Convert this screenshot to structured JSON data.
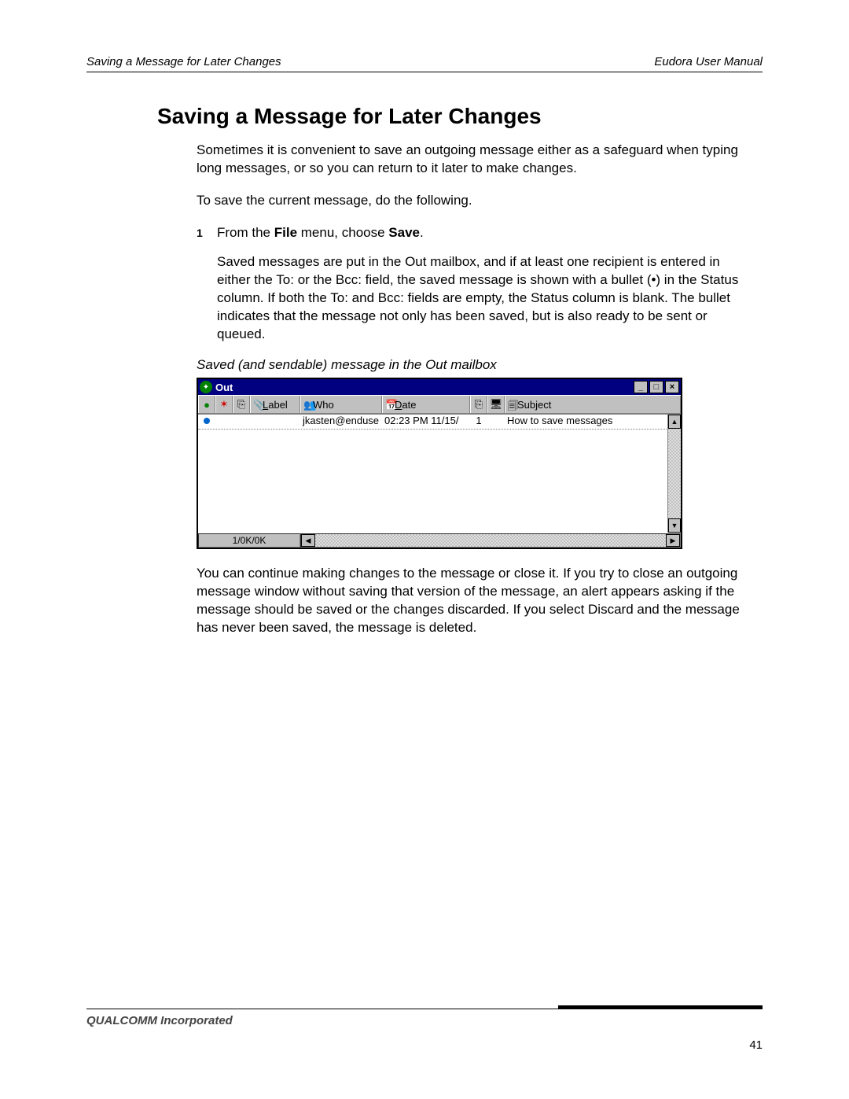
{
  "header": {
    "left": "Saving a Message for Later Changes",
    "right": "Eudora User Manual"
  },
  "title": "Saving a Message for Later Changes",
  "para1": "Sometimes it is convenient to save an outgoing message either as a safeguard when typing long messages, or so you can return to it later to make changes.",
  "para2": "To save the current message, do the following.",
  "step": {
    "num": "1",
    "text_prefix": "From the ",
    "menu": "File",
    "text_mid": " menu, choose ",
    "action": "Save",
    "text_suffix": "."
  },
  "para3": "Saved messages are put in the Out mailbox, and if at least one recipient is entered in either the To: or the Bcc: field, the saved message is shown with a bullet (•) in the Status column. If both the To: and Bcc: fields are empty, the Status column is blank. The bullet indicates that the message not only has been saved, but is also ready to be sent or queued.",
  "caption": "Saved (and sendable) message in the Out mailbox",
  "window": {
    "title": "Out",
    "columns": {
      "label_l": "L",
      "label_rest": "abel",
      "who_w": "W",
      "who_rest": "ho",
      "date_d": "D",
      "date_rest": "ate",
      "subj_s": "S",
      "subj_rest": "ubject"
    },
    "row": {
      "who": "jkasten@enduse",
      "date": "02:23 PM 11/15/",
      "size": "1",
      "subject": "How to save messages"
    },
    "status": "1/0K/0K"
  },
  "para4": "You can continue making changes to the message or close it. If you try to close an outgoing message window without saving that version of the message, an alert appears asking if the message should be saved or the changes discarded. If you select Discard and the message has never been saved, the message is deleted.",
  "footer": {
    "company": "QUALCOMM Incorporated",
    "page": "41"
  }
}
